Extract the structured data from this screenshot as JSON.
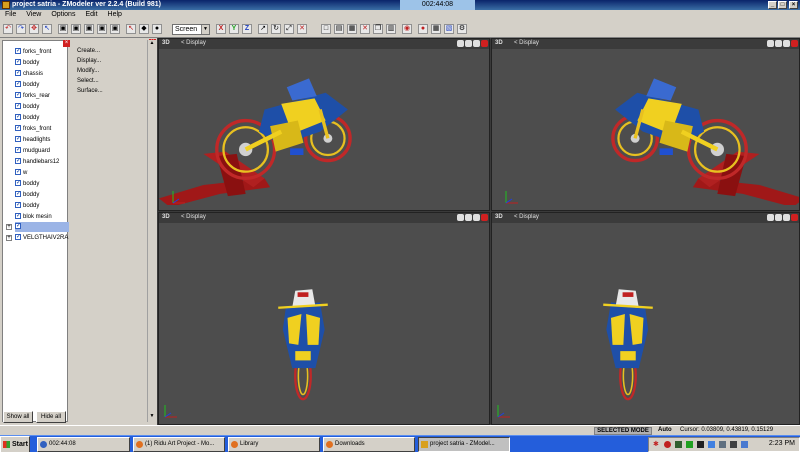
{
  "window": {
    "title": "project satria - ZModeler ver 2.2.4 (Build 981)",
    "timer": "002:44:08"
  },
  "menu": [
    "File",
    "View",
    "Options",
    "Edit",
    "Help"
  ],
  "toolbar": {
    "view_mode": "Screen"
  },
  "tree": {
    "items": [
      {
        "label": "forks_front"
      },
      {
        "label": "boddy"
      },
      {
        "label": "chassis"
      },
      {
        "label": "boddy"
      },
      {
        "label": "forks_rear"
      },
      {
        "label": "boddy"
      },
      {
        "label": "boddy"
      },
      {
        "label": "froks_front"
      },
      {
        "label": "headlights"
      },
      {
        "label": "mudguard"
      },
      {
        "label": "handlebars12"
      },
      {
        "label": "w"
      },
      {
        "label": "boddy"
      },
      {
        "label": "boddy"
      },
      {
        "label": "boddy"
      },
      {
        "label": "blok mesin"
      },
      {
        "label": ""
      },
      {
        "label": "VELGTHAIV2RA"
      }
    ],
    "show_all": "Show all",
    "hide_all": "Hide all"
  },
  "commands": [
    "Create...",
    "Display...",
    "Modify...",
    "Select...",
    "Surface..."
  ],
  "viewports": [
    {
      "mode": "3D",
      "label": "Display"
    },
    {
      "mode": "3D",
      "label": "Display"
    },
    {
      "mode": "3D",
      "label": "Display"
    },
    {
      "mode": "3D",
      "label": "Display"
    }
  ],
  "status": {
    "mode": "SELECTED MODE",
    "auto": "Auto",
    "cursor": "Cursor: 0.03809, 0.43819, 0.15129"
  },
  "taskbar": {
    "start": "Start",
    "tasks": [
      "002:44:08",
      "(1) Ridu Art Project - Mo...",
      "Library",
      "Downloads",
      "project satria - ZModel..."
    ],
    "clock": "2:23 PM"
  }
}
